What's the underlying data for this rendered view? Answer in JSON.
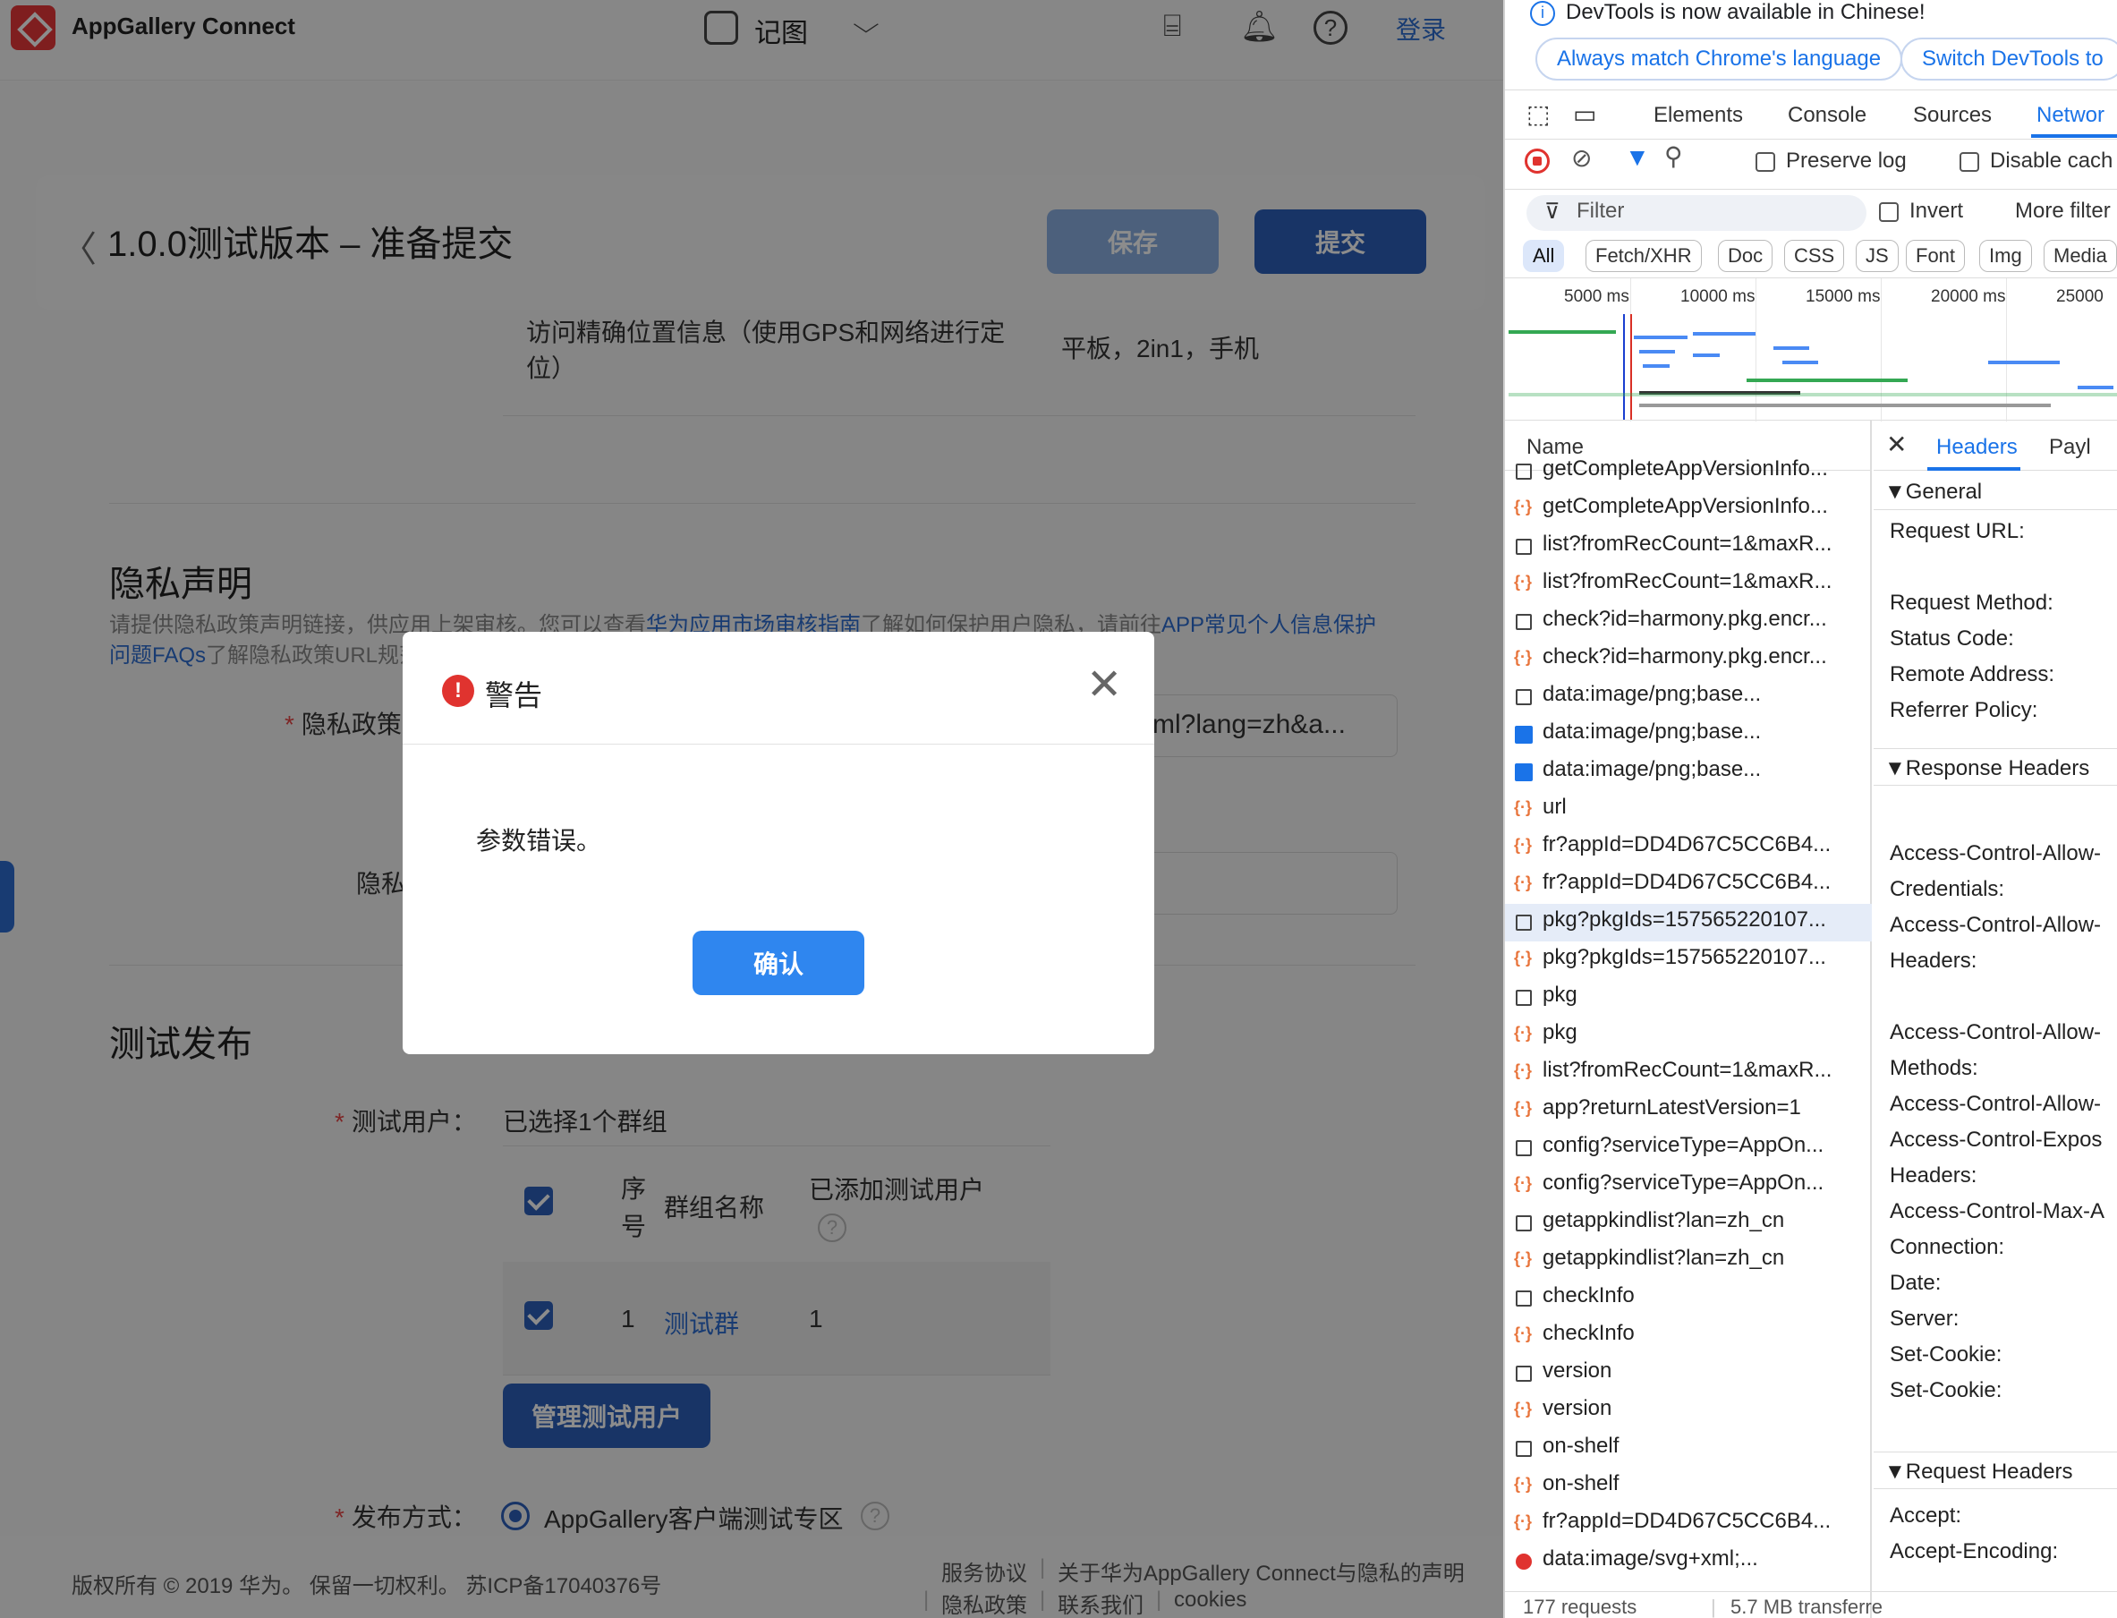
{
  "topbar": {
    "brand": "AppGallery Connect",
    "app_name": "记图",
    "chevron": "⌵",
    "login": "登录",
    "icons": [
      "presentation-icon",
      "bell-icon",
      "help-icon"
    ]
  },
  "header": {
    "back": "〈",
    "title": "1.0.0测试版本 – 准备提交",
    "save_label": "保存",
    "submit_label": "提交"
  },
  "content": {
    "truncated_line1": "访问精确位置信息（使用GPS和网络进行定",
    "truncated_line2": "位）",
    "platform": "平板，2in1，手机",
    "privacy": {
      "title": "隐私声明",
      "desc_part1": "请提供隐私政策声明链接，供应用上架审核。您可以查看",
      "desc_link1": "华为应用市场审核指南",
      "desc_part2": "了解如何保护用户隐私，请前往",
      "desc_link2": "APP常见个人信息保护问题FAQs",
      "desc_part3": "了解隐私政策URL规范。",
      "policy_label": "隐私政策",
      "policy_value": "html?lang=zh&a...",
      "second_label": "隐私"
    },
    "test_release": {
      "title": "测试发布",
      "users_label": "测试用户：",
      "users_value": "已选择1个群组",
      "table": {
        "col_no": "序号",
        "col_group": "群组名称",
        "col_added": "已添加测试用户",
        "row_no": "1",
        "row_group": "测试群",
        "row_added": "1"
      },
      "manage_label": "管理测试用户",
      "method_label": "发布方式：",
      "method_value": "AppGallery客户端测试专区"
    }
  },
  "footer": {
    "copyright": "版权所有 © 2019 华为。 保留一切权利。 苏ICP备17040376号",
    "links_row1": [
      "服务协议",
      "关于华为AppGallery Connect与隐私的声明"
    ],
    "links_row2": [
      "隐私政策",
      "联系我们",
      "cookies"
    ]
  },
  "modal": {
    "title": "警告",
    "message": "参数错误。",
    "ok_label": "确认",
    "close": "✕"
  },
  "devtools": {
    "info": "DevTools is now available in Chinese!",
    "pill1": "Always match Chrome's language",
    "pill2": "Switch DevTools to",
    "tabs": [
      "Elements",
      "Console",
      "Sources",
      "Networ"
    ],
    "preserve_log": "Preserve log",
    "disable_cache": "Disable cach",
    "filter_placeholder": "Filter",
    "invert": "Invert",
    "more_filters": "More filter",
    "chips": [
      "All",
      "Fetch/XHR",
      "Doc",
      "CSS",
      "JS",
      "Font",
      "Img",
      "Media"
    ],
    "ticks": [
      "5000 ms",
      "10000 ms",
      "15000 ms",
      "20000 ms",
      "25000"
    ],
    "name_header": "Name",
    "requests": [
      {
        "name": "getCompleteAppVersionInfo...",
        "type": "doc"
      },
      {
        "name": "getCompleteAppVersionInfo...",
        "type": "xhr"
      },
      {
        "name": "list?fromRecCount=1&maxR...",
        "type": "doc"
      },
      {
        "name": "list?fromRecCount=1&maxR...",
        "type": "xhr"
      },
      {
        "name": "check?id=harmony.pkg.encr...",
        "type": "doc"
      },
      {
        "name": "check?id=harmony.pkg.encr...",
        "type": "xhr"
      },
      {
        "name": "data:image/png;base...",
        "type": "doc"
      },
      {
        "name": "data:image/png;base...",
        "type": "img"
      },
      {
        "name": "data:image/png;base...",
        "type": "img"
      },
      {
        "name": "url",
        "type": "xhr"
      },
      {
        "name": "fr?appId=DD4D67C5CC6B4...",
        "type": "xhr"
      },
      {
        "name": "fr?appId=DD4D67C5CC6B4...",
        "type": "xhr"
      },
      {
        "name": "pkg?pkgIds=157565220107...",
        "type": "doc",
        "selected": true
      },
      {
        "name": "pkg?pkgIds=157565220107...",
        "type": "xhr"
      },
      {
        "name": "pkg",
        "type": "doc"
      },
      {
        "name": "pkg",
        "type": "xhr"
      },
      {
        "name": "list?fromRecCount=1&maxR...",
        "type": "xhr"
      },
      {
        "name": "app?returnLatestVersion=1",
        "type": "xhr"
      },
      {
        "name": "config?serviceType=AppOn...",
        "type": "doc"
      },
      {
        "name": "config?serviceType=AppOn...",
        "type": "xhr"
      },
      {
        "name": "getappkindlist?lan=zh_cn",
        "type": "doc"
      },
      {
        "name": "getappkindlist?lan=zh_cn",
        "type": "xhr"
      },
      {
        "name": "checkInfo",
        "type": "doc"
      },
      {
        "name": "checkInfo",
        "type": "xhr"
      },
      {
        "name": "version",
        "type": "doc"
      },
      {
        "name": "version",
        "type": "xhr"
      },
      {
        "name": "on-shelf",
        "type": "doc"
      },
      {
        "name": "on-shelf",
        "type": "xhr"
      },
      {
        "name": "fr?appId=DD4D67C5CC6B4...",
        "type": "xhr"
      },
      {
        "name": "data:image/svg+xml;...",
        "type": "err"
      }
    ],
    "status_requests": "177 requests",
    "status_transfer": "5.7 MB transferre",
    "detail": {
      "close": "✕",
      "tab_headers": "Headers",
      "tab_payload": "Payl",
      "general": "▼General",
      "general_lines": [
        "Request URL:",
        "Request Method:",
        "Status Code:",
        "Remote Address:",
        "Referrer Policy:"
      ],
      "response_headers": "▼Response Headers",
      "response_lines": [
        "Access-Control-Allow-",
        "Credentials:",
        "Access-Control-Allow-",
        "Headers:",
        "Access-Control-Allow-",
        "Methods:",
        "Access-Control-Allow-",
        "Access-Control-Expos",
        "Headers:",
        "Access-Control-Max-A",
        "Connection:",
        "Date:",
        "Server:",
        "Set-Cookie:",
        "Set-Cookie:"
      ],
      "request_headers": "▼Request Headers",
      "request_lines": [
        "Accept:",
        "Accept-Encoding:"
      ]
    }
  }
}
